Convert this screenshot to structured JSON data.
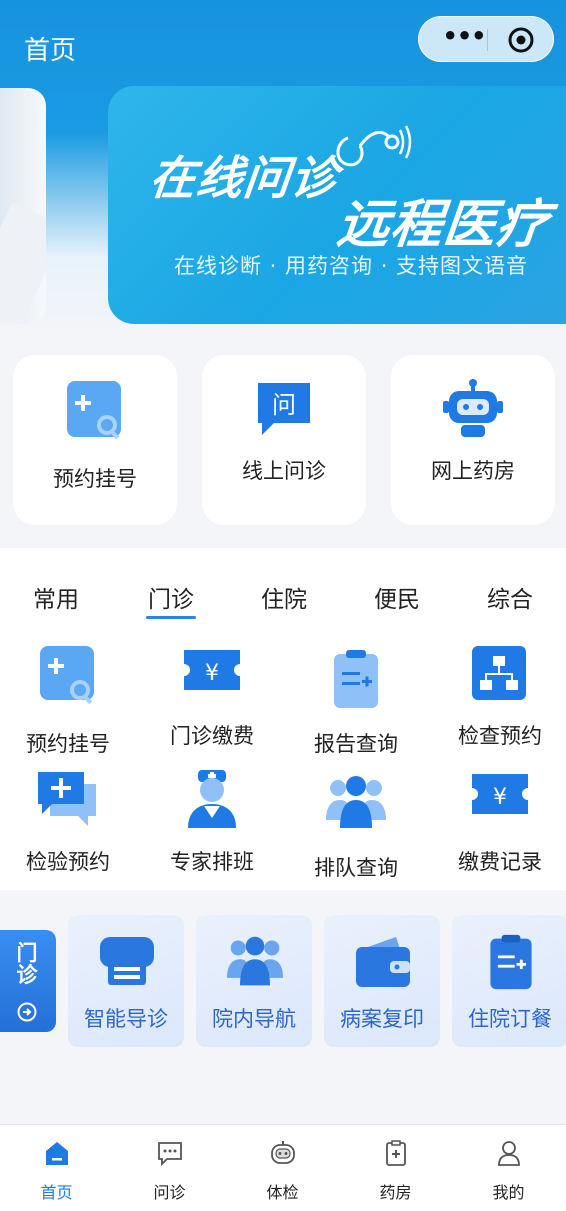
{
  "header": {
    "title": "首页"
  },
  "banner": {
    "line1": "在线问诊",
    "line2": "远程医疗",
    "subtitle": "在线诊断 · 用药咨询 · 支持图文语音"
  },
  "quick_cards": [
    {
      "label": "预约挂号",
      "icon": "appointment-icon"
    },
    {
      "label": "线上问诊",
      "icon": "consult-icon"
    },
    {
      "label": "网上药房",
      "icon": "robot-icon"
    }
  ],
  "tabs": [
    {
      "label": "常用",
      "active": false
    },
    {
      "label": "门诊",
      "active": true
    },
    {
      "label": "住院",
      "active": false
    },
    {
      "label": "便民",
      "active": false
    },
    {
      "label": "综合",
      "active": false
    }
  ],
  "grid": [
    {
      "label": "预约挂号",
      "icon": "appointment-icon"
    },
    {
      "label": "门诊缴费",
      "icon": "ticket-yen-icon"
    },
    {
      "label": "报告查询",
      "icon": "clipboard-icon"
    },
    {
      "label": "检查预约",
      "icon": "org-chart-icon"
    },
    {
      "label": "检验预约",
      "icon": "chat-plus-icon"
    },
    {
      "label": "专家排班",
      "icon": "doctor-icon"
    },
    {
      "label": "排队查询",
      "icon": "people-icon"
    },
    {
      "label": "缴费记录",
      "icon": "ticket-yen-icon"
    }
  ],
  "service_strip": {
    "tag": "门诊",
    "items": [
      {
        "label": "智能导诊",
        "icon": "printer-icon"
      },
      {
        "label": "院内导航",
        "icon": "people-icon"
      },
      {
        "label": "病案复印",
        "icon": "wallet-icon"
      },
      {
        "label": "住院订餐",
        "icon": "clipboard-icon"
      }
    ]
  },
  "bottom_nav": [
    {
      "label": "首页",
      "icon": "home-icon",
      "active": true
    },
    {
      "label": "问诊",
      "icon": "chat-icon",
      "active": false
    },
    {
      "label": "体检",
      "icon": "robot-icon",
      "active": false
    },
    {
      "label": "药房",
      "icon": "medicine-box-icon",
      "active": false
    },
    {
      "label": "我的",
      "icon": "user-icon",
      "active": false
    }
  ],
  "colors": {
    "primary": "#1a9be3",
    "accent": "#2a83e6",
    "active_nav": "#1f7be0"
  }
}
